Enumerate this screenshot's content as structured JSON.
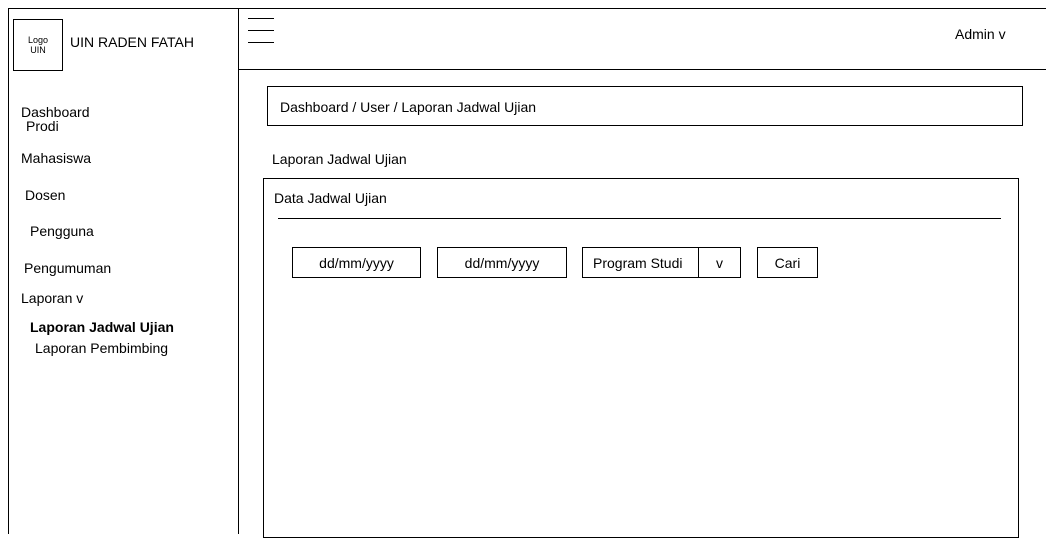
{
  "brand": {
    "logo_line1": "Logo",
    "logo_line2": "UIN",
    "name": "UIN RADEN FATAH"
  },
  "header": {
    "user_label": "Admin v"
  },
  "sidebar": {
    "items": [
      {
        "label": "Dashboard"
      },
      {
        "label": "Prodi"
      },
      {
        "label": "Mahasiswa"
      },
      {
        "label": "Dosen"
      },
      {
        "label": "Pengguna"
      },
      {
        "label": "Pengumuman"
      },
      {
        "label": "Laporan v"
      },
      {
        "label": "Laporan Jadwal Ujian"
      },
      {
        "label": "Laporan Pembimbing"
      }
    ]
  },
  "main": {
    "breadcrumb": "Dashboard / User / Laporan Jadwal Ujian",
    "page_title": "Laporan Jadwal Ujian",
    "card_title": "Data Jadwal Ujian",
    "filters": {
      "date_from": "dd/mm/yyyy",
      "date_to": "dd/mm/yyyy",
      "program_select": "Program Studi",
      "program_caret": "v",
      "search_button": "Cari"
    }
  }
}
